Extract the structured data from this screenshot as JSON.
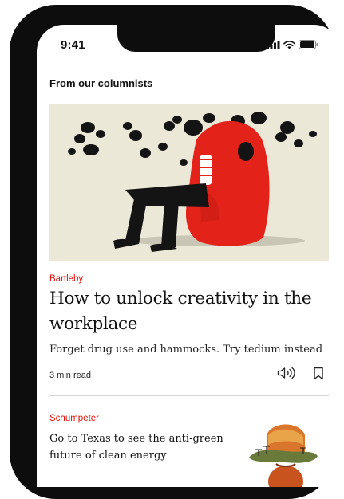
{
  "status_bar": {
    "time": "9:41"
  },
  "section": {
    "title": "From our columnists"
  },
  "featured": {
    "kicker": "Bartleby",
    "headline": "How to unlock creativity in the workplace",
    "standfirst": "Forget drug use and hammocks. Try tedium instead",
    "read_time": "3 min read",
    "image": "illustration-person-in-red-armchair-with-ink-blots"
  },
  "second": {
    "kicker": "Schumpeter",
    "headline": "Go to Texas to see the anti-green future of clean energy",
    "image": "illustration-cowboy-hat-with-wind-turbines"
  },
  "colors": {
    "accent": "#e3120b",
    "text": "#111111"
  },
  "icons": {
    "listen": "speaker-icon",
    "bookmark": "bookmark-icon",
    "signal": "cellular-signal-icon",
    "wifi": "wifi-icon",
    "battery": "battery-icon"
  }
}
